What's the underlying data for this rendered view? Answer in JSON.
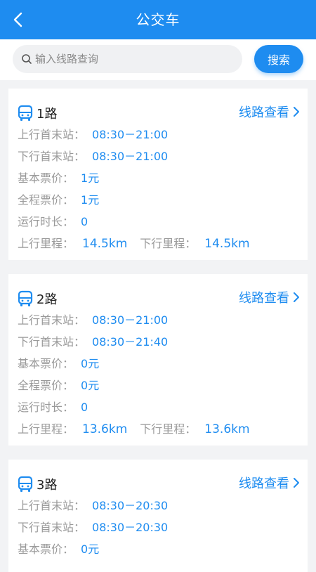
{
  "header": {
    "title": "公交车"
  },
  "search": {
    "placeholder": "输入线路查询",
    "button_label": "搜索"
  },
  "routes": [
    {
      "name": "1路",
      "view_label": "线路查看",
      "up_first_last_label": "上行首末站：",
      "up_first_last": "08:30－21:00",
      "down_first_last_label": "下行首末站：",
      "down_first_last": "08:30－21:00",
      "base_fare_label": "基本票价：",
      "base_fare": "1元",
      "full_fare_label": "全程票价：",
      "full_fare": "1元",
      "duration_label": "运行时长：",
      "duration": "0",
      "up_distance_label": "上行里程：",
      "up_distance": "14.5km",
      "down_distance_label": "下行里程：",
      "down_distance": "14.5km"
    },
    {
      "name": "2路",
      "view_label": "线路查看",
      "up_first_last_label": "上行首末站：",
      "up_first_last": "08:30－21:00",
      "down_first_last_label": "下行首末站：",
      "down_first_last": "08:30－21:40",
      "base_fare_label": "基本票价：",
      "base_fare": "0元",
      "full_fare_label": "全程票价：",
      "full_fare": "0元",
      "duration_label": "运行时长：",
      "duration": "0",
      "up_distance_label": "上行里程：",
      "up_distance": "13.6km",
      "down_distance_label": "下行里程：",
      "down_distance": "13.6km"
    },
    {
      "name": "3路",
      "view_label": "线路查看",
      "up_first_last_label": "上行首末站：",
      "up_first_last": "08:30－20:30",
      "down_first_last_label": "下行首末站：",
      "down_first_last": "08:30－20:30",
      "base_fare_label": "基本票价：",
      "base_fare": "0元"
    }
  ],
  "colors": {
    "accent": "#1e8cf0",
    "label_gray": "#9a9a9a",
    "background": "#f2f3f5"
  },
  "icons": {
    "back": "back-arrow-icon",
    "search": "search-icon",
    "bus": "bus-icon",
    "chevron": "chevron-right-icon"
  }
}
